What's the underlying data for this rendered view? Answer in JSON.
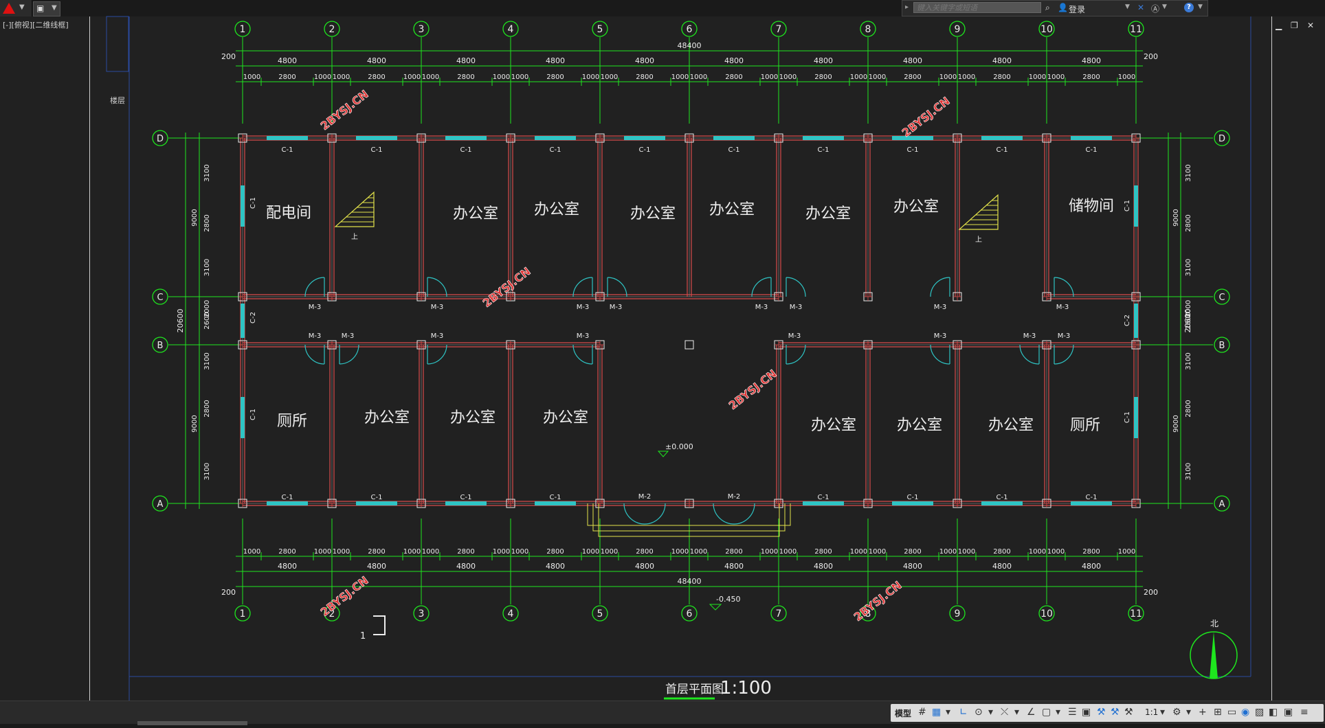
{
  "topbar": {
    "search_placeholder": "键入关键字或短语",
    "login_label": "登录"
  },
  "viewport_label": "[-][俯视][二维线框]",
  "drawing": {
    "title": "首层平面图",
    "scale": "1:100",
    "grid_columns": [
      "1",
      "2",
      "3",
      "4",
      "5",
      "6",
      "7",
      "8",
      "9",
      "10",
      "11"
    ],
    "grid_rows": [
      "D",
      "C",
      "B",
      "A"
    ],
    "total_width": "48400",
    "total_depth": "20600",
    "bay_dims": [
      "4800",
      "4800",
      "4800",
      "4800",
      "4800",
      "4800",
      "4800",
      "4800",
      "4800",
      "4800"
    ],
    "sub_dims_top": [
      "1000",
      "2800",
      "1000",
      "1000",
      "2800",
      "1000",
      "1000",
      "2800",
      "1000",
      "1000",
      "2800",
      "1000",
      "1000",
      "2800",
      "1000",
      "1000",
      "2800",
      "1000",
      "1000",
      "2800",
      "1000",
      "1000",
      "2800",
      "1000",
      "1000",
      "2800",
      "1000",
      "1000",
      "2800",
      "1000"
    ],
    "edge_dim": "200",
    "depth_dims": [
      "3100",
      "2800",
      "3100",
      "9000",
      "2000",
      "2600",
      "3100",
      "2800",
      "3100",
      "9000"
    ],
    "rooms_top": [
      "配电间",
      "办公室",
      "办公室",
      "办公室",
      "办公室",
      "办公室",
      "办公室",
      "储物间"
    ],
    "rooms_bottom": [
      "厕所",
      "办公室",
      "办公室",
      "办公室",
      "办公室",
      "办公室",
      "办公室",
      "厕所"
    ],
    "window_label": "C-1",
    "window_label_2": "C-2",
    "door_label_m3": "M-3",
    "door_label_m2": "M-2",
    "stair_label": "上",
    "level_0": "±0.000",
    "level_ext": "-0.450",
    "section_mark": "1",
    "north_label": "北",
    "watermark": "2BYSJ.CN",
    "side_label": "楼层"
  },
  "statusbar": {
    "model_label": "模型",
    "scale_label": "1:1"
  },
  "colors": {
    "background": "#212121",
    "dimension": "#1ee61e",
    "wall": "#d84b4b",
    "window": "#2ec4c4",
    "stair": "#e3e34a",
    "text": "#ededed",
    "watermark": "#e03535"
  }
}
